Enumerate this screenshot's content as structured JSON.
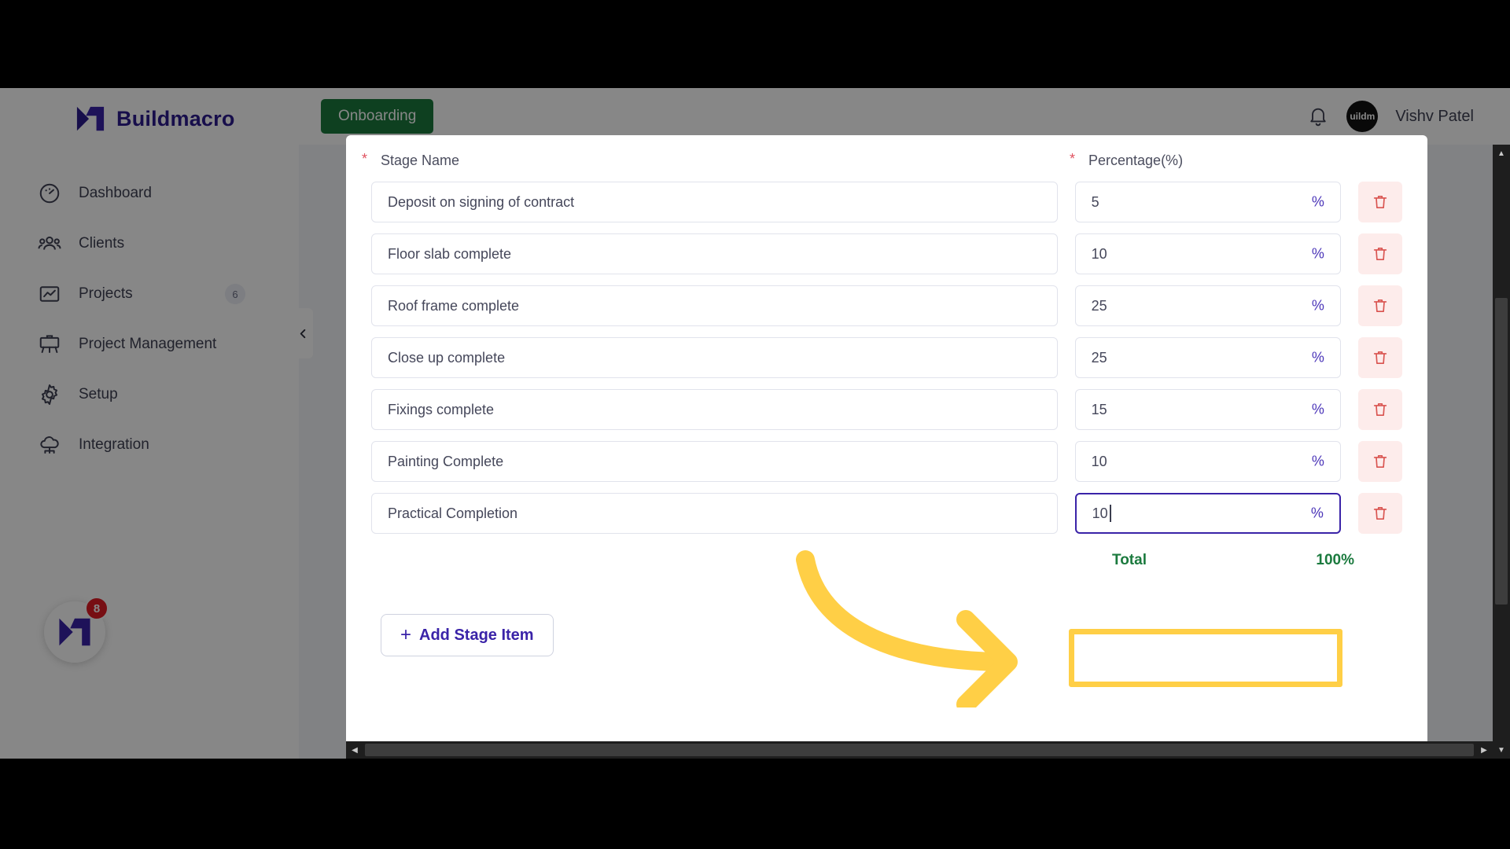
{
  "brand": {
    "name": "Buildmacro"
  },
  "sidebar": {
    "items": [
      {
        "label": "Dashboard",
        "icon": "dashboard-icon",
        "badge": null
      },
      {
        "label": "Clients",
        "icon": "clients-icon",
        "badge": null
      },
      {
        "label": "Projects",
        "icon": "projects-icon",
        "badge": "6"
      },
      {
        "label": "Project Management",
        "icon": "project-management-icon",
        "badge": null
      },
      {
        "label": "Setup",
        "icon": "setup-gear-icon",
        "badge": null
      },
      {
        "label": "Integration",
        "icon": "integration-cloud-icon",
        "badge": null
      }
    ],
    "collapse_icon": "chevron-left-icon",
    "chat_fab": {
      "badge": "8",
      "icon": "buildmacro-logo-icon"
    }
  },
  "topbar": {
    "onboarding_label": "Onboarding",
    "bell_icon": "notification-bell-icon",
    "avatar_text": "uildm",
    "user_name": "Vishv Patel"
  },
  "modal": {
    "columns": {
      "stage_name": "Stage Name",
      "percentage": "Percentage(%)",
      "required_marker": "*"
    },
    "rows": [
      {
        "stage": "Deposit on signing of contract",
        "percent": "5",
        "active": false
      },
      {
        "stage": "Floor slab complete",
        "percent": "10",
        "active": false
      },
      {
        "stage": "Roof frame complete",
        "percent": "25",
        "active": false
      },
      {
        "stage": "Close up complete",
        "percent": "25",
        "active": false
      },
      {
        "stage": "Fixings complete",
        "percent": "15",
        "active": false
      },
      {
        "stage": "Painting Complete",
        "percent": "10",
        "active": false
      },
      {
        "stage": "Practical Completion",
        "percent": "10",
        "active": true
      }
    ],
    "percent_sign": "%",
    "delete_icon": "trash-icon",
    "total": {
      "label": "Total",
      "value": "100%"
    },
    "add_button": {
      "plus": "+",
      "label": "Add Stage Item"
    }
  },
  "annotation": {
    "arrow": "curved-right-arrow",
    "color": "#FFCF46"
  },
  "scrollbars": {
    "vertical": {
      "up": "▲",
      "down": "▼"
    },
    "horizontal": {
      "left": "◀",
      "right": "▶"
    }
  },
  "colors": {
    "brand_purple": "#2D1B8F",
    "accent_purple": "#3A23A8",
    "onboarding_green": "#1B7A3E",
    "total_green": "#1B7A3E",
    "delete_red": "#D9534F",
    "badge_red": "#E01B24",
    "highlight_yellow": "#FFCF46"
  }
}
